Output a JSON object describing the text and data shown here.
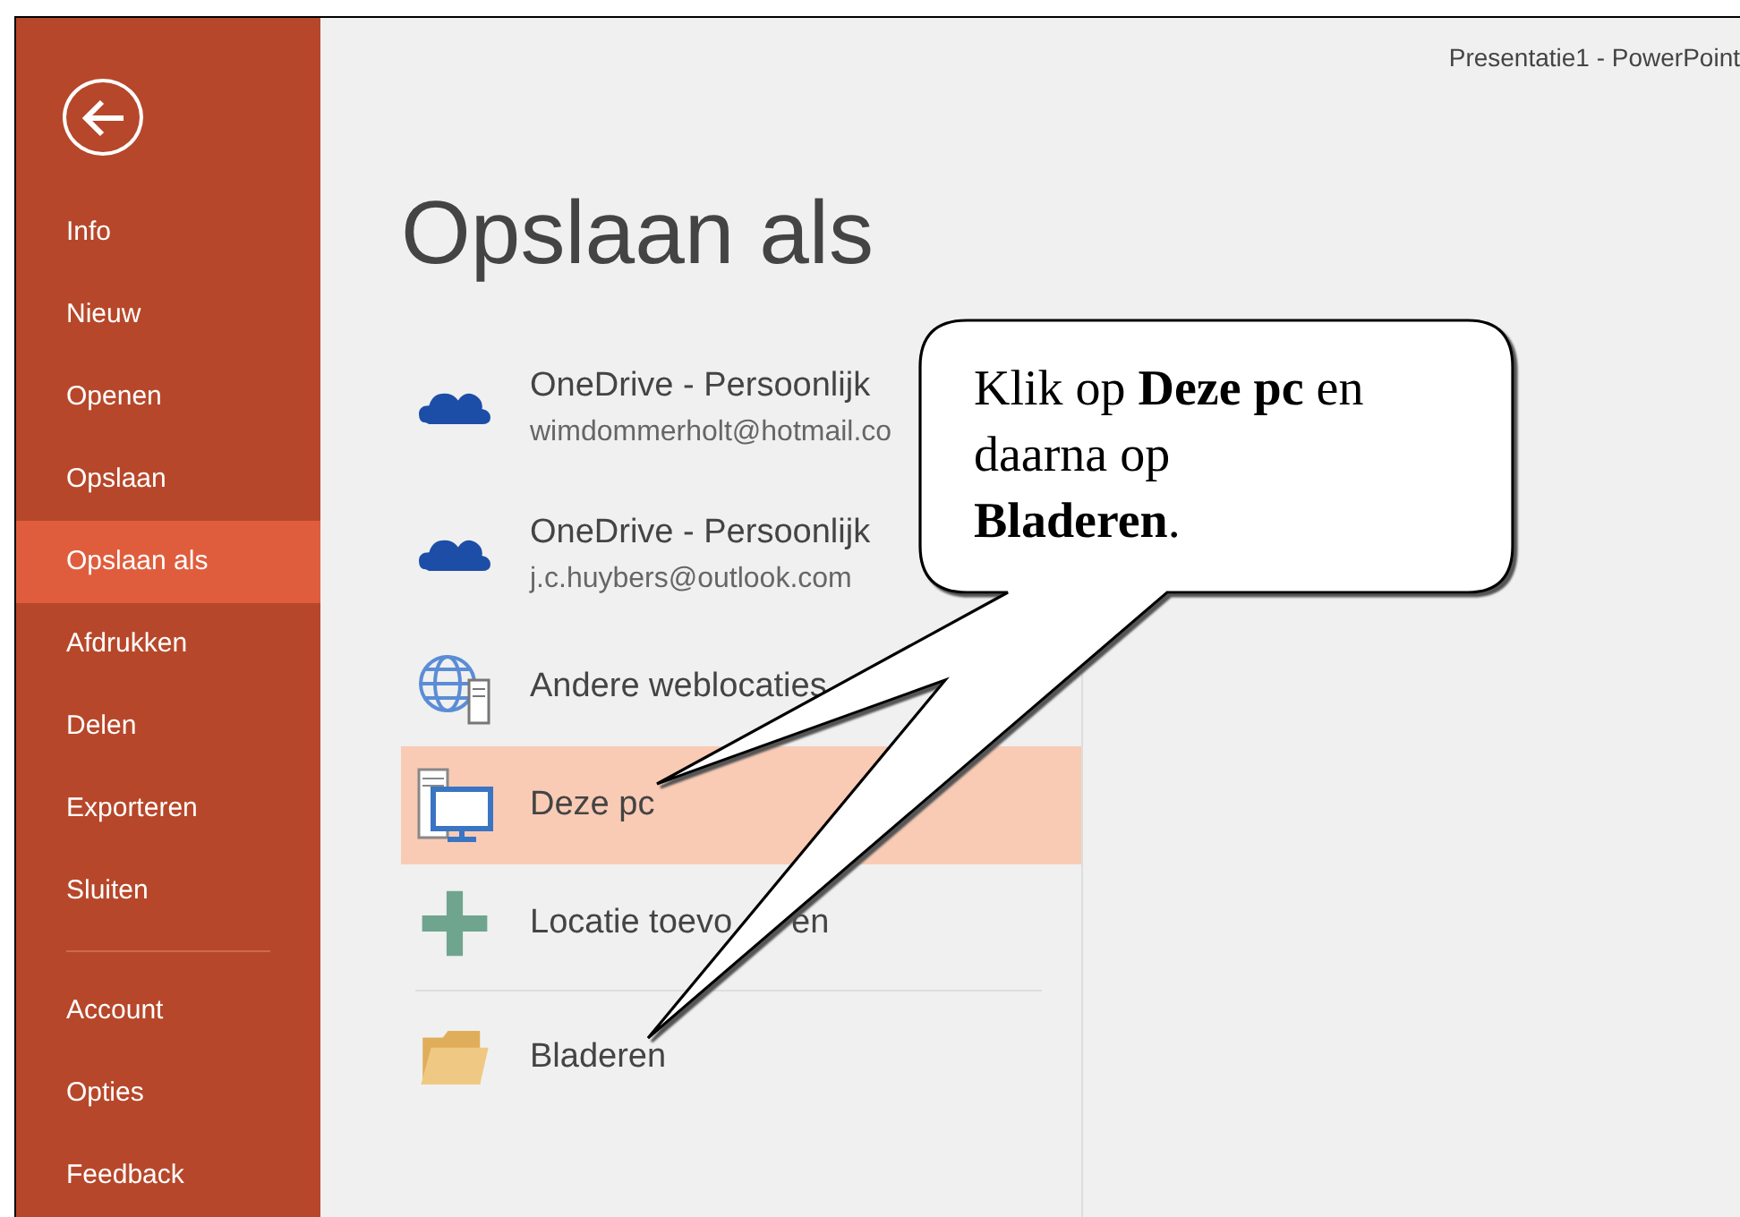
{
  "window": {
    "title": "Presentatie1 - PowerPoint"
  },
  "sidebar": {
    "items": [
      {
        "label": "Info",
        "selected": false
      },
      {
        "label": "Nieuw",
        "selected": false
      },
      {
        "label": "Openen",
        "selected": false
      },
      {
        "label": "Opslaan",
        "selected": false
      },
      {
        "label": "Opslaan als",
        "selected": true
      },
      {
        "label": "Afdrukken",
        "selected": false
      },
      {
        "label": "Delen",
        "selected": false
      },
      {
        "label": "Exporteren",
        "selected": false
      },
      {
        "label": "Sluiten",
        "selected": false
      }
    ],
    "footer_items": [
      {
        "label": "Account",
        "selected": false
      },
      {
        "label": "Opties",
        "selected": false
      },
      {
        "label": "Feedback",
        "selected": false
      }
    ]
  },
  "page_title": "Opslaan als",
  "locations": [
    {
      "kind": "onedrive",
      "label": "OneDrive - Persoonlijk",
      "detail": "wimdommerholt@hotmail.co",
      "selected": false
    },
    {
      "kind": "onedrive",
      "label": "OneDrive - Persoonlijk",
      "detail": "j.c.huybers@outlook.com",
      "selected": false
    },
    {
      "kind": "web",
      "label": "Andere weblocaties",
      "selected": false
    },
    {
      "kind": "pc",
      "label": "Deze pc",
      "selected": true
    },
    {
      "kind": "add",
      "label": "Locatie toevo",
      "label_end": "en",
      "selected": false
    },
    {
      "kind": "browse",
      "label": "Bladeren",
      "selected": false
    }
  ],
  "callout": {
    "text": "Klik op **Deze pc** en daarna op **Bladeren**."
  }
}
